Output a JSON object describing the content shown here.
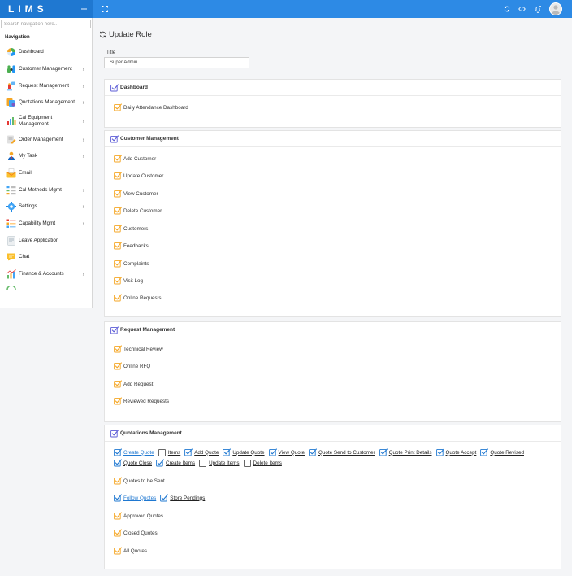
{
  "app": {
    "logo": "LIMS"
  },
  "sidebar": {
    "search_placeholder": "Search navigation here..",
    "heading": "Navigation",
    "items": [
      {
        "label": "Dashboard",
        "has_children": false
      },
      {
        "label": "Customer Management",
        "has_children": true
      },
      {
        "label": "Request Management",
        "has_children": true
      },
      {
        "label": "Quotations Management",
        "has_children": true
      },
      {
        "label": "Cal Equipment Management",
        "has_children": true
      },
      {
        "label": "Order Management",
        "has_children": true
      },
      {
        "label": "My Task",
        "has_children": true
      },
      {
        "label": "Email",
        "has_children": false
      },
      {
        "label": "Cal Methods Mgmt",
        "has_children": true
      },
      {
        "label": "Settings",
        "has_children": true
      },
      {
        "label": "Capability Mgmt",
        "has_children": true
      },
      {
        "label": "Leave Application",
        "has_children": false
      },
      {
        "label": "Chat",
        "has_children": false
      },
      {
        "label": "Finance & Accounts",
        "has_children": true
      }
    ]
  },
  "page": {
    "title": "Update Role",
    "title_field_label": "Title",
    "title_field_value": "Super Admin"
  },
  "sections": {
    "dashboard": {
      "title": "Dashboard",
      "permissions": [
        "Daily Attendance Dashboard"
      ]
    },
    "customer": {
      "title": "Customer Management",
      "permissions": [
        "Add Customer",
        "Update Customer",
        "View Customer",
        "Delete Customer",
        "Customers",
        "Feedbacks",
        "Complaints",
        "Visit Log",
        "Online Requests"
      ]
    },
    "request": {
      "title": "Request Management",
      "permissions": [
        "Technical Review",
        "Online RFQ",
        "Add Request",
        "Reviewed Requests"
      ]
    },
    "quotations": {
      "title": "Quotations Management",
      "create_quote_row": [
        {
          "label": "Create Quote",
          "checked": true,
          "primary": true
        },
        {
          "label": "Items",
          "checked": false
        },
        {
          "label": "Add Quote",
          "checked": true
        },
        {
          "label": "Update Quote",
          "checked": true
        },
        {
          "label": "View Quote",
          "checked": true
        },
        {
          "label": "Quote Send to Customer",
          "checked": true
        },
        {
          "label": "Quote Print Details",
          "checked": true
        },
        {
          "label": "Quote Accept",
          "checked": true
        },
        {
          "label": "Quote Revised",
          "checked": true
        }
      ],
      "create_quote_row2": [
        {
          "label": "Quote Close",
          "checked": true
        },
        {
          "label": "Create Items",
          "checked": true
        },
        {
          "label": "Update Items",
          "checked": false
        },
        {
          "label": "Delete Items",
          "checked": false
        }
      ],
      "quotes_to_be_sent": "Quotes to be Sent",
      "follow_row": [
        {
          "label": "Follow Quotes",
          "checked": true,
          "primary": true
        },
        {
          "label": "Store Pendings",
          "checked": true
        }
      ],
      "permissions_after": [
        "Approved Quotes",
        "Closed Quotes",
        "All Quotes"
      ]
    }
  },
  "colors": {
    "topbar": "#2d8ae5",
    "brand": "#1f78d1",
    "section_check": "#5b5bd6",
    "perm_check": "#f5a623",
    "sub_check": "#1f78d1"
  }
}
